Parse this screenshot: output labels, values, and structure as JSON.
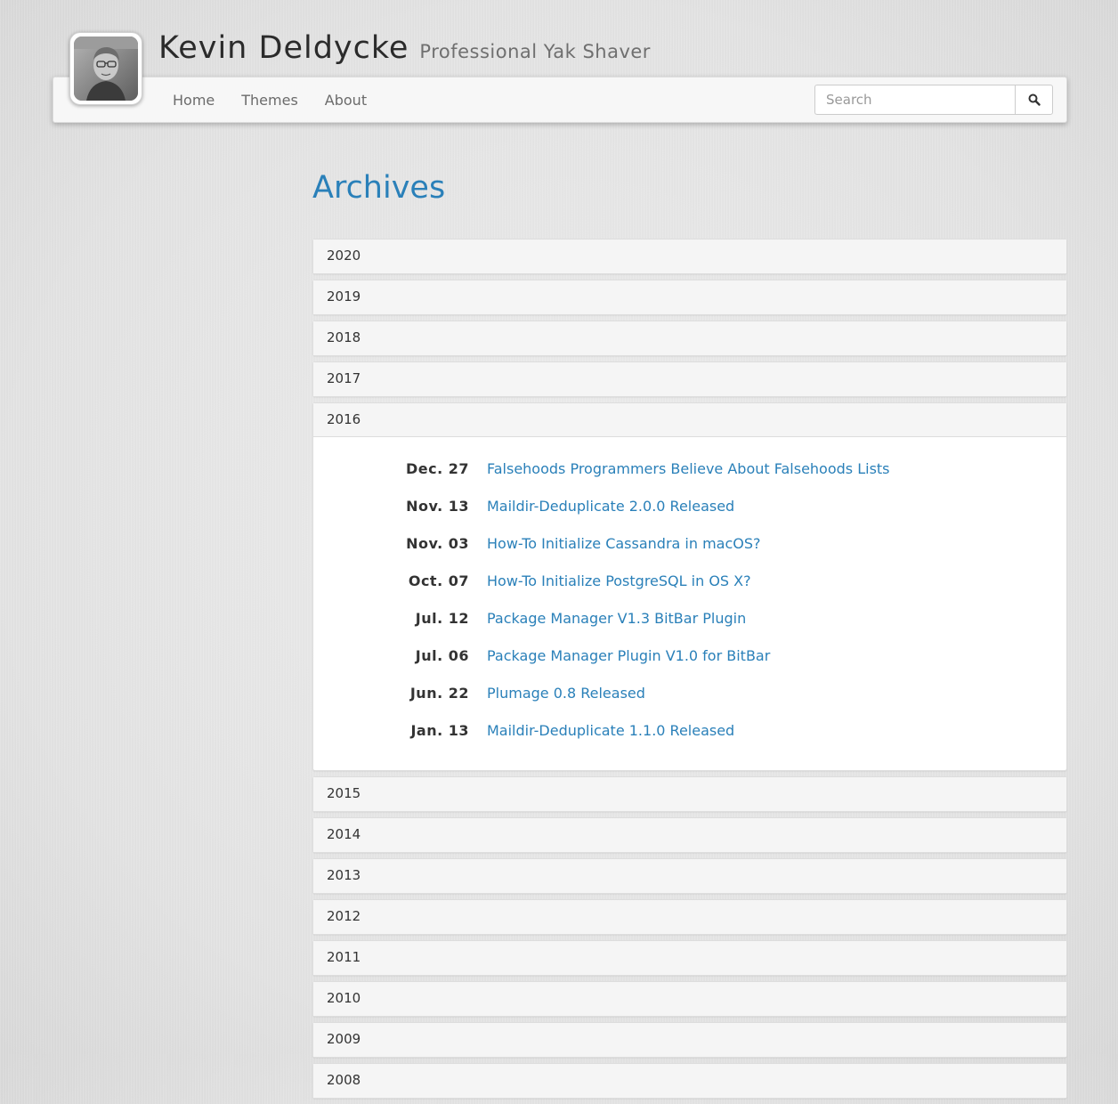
{
  "site": {
    "name": "Kevin Deldycke",
    "tagline": "Professional Yak Shaver",
    "avatar_icon": "portrait-photo"
  },
  "nav": {
    "items": [
      {
        "label": "Home"
      },
      {
        "label": "Themes"
      },
      {
        "label": "About"
      }
    ],
    "search_placeholder": "Search",
    "search_icon": "search-icon"
  },
  "page": {
    "title": "Archives"
  },
  "colors": {
    "accent": "#2a80b9",
    "text": "#333333",
    "panel_heading_bg": "#f5f5f5"
  },
  "archives": {
    "years_before": [
      "2020",
      "2019",
      "2018",
      "2017"
    ],
    "open_year": {
      "year": "2016",
      "posts": [
        {
          "date": "Dec. 27",
          "title": "Falsehoods Programmers Believe About Falsehoods Lists"
        },
        {
          "date": "Nov. 13",
          "title": "Maildir-Deduplicate 2.0.0 Released"
        },
        {
          "date": "Nov. 03",
          "title": "How-To Initialize Cassandra in macOS?"
        },
        {
          "date": "Oct. 07",
          "title": "How-To Initialize PostgreSQL in OS X?"
        },
        {
          "date": "Jul. 12",
          "title": "Package Manager V1.3 BitBar Plugin"
        },
        {
          "date": "Jul. 06",
          "title": "Package Manager Plugin V1.0 for BitBar"
        },
        {
          "date": "Jun. 22",
          "title": "Plumage 0.8 Released"
        },
        {
          "date": "Jan. 13",
          "title": "Maildir-Deduplicate 1.1.0 Released"
        }
      ]
    },
    "years_after": [
      "2015",
      "2014",
      "2013",
      "2012",
      "2011",
      "2010",
      "2009",
      "2008"
    ]
  }
}
